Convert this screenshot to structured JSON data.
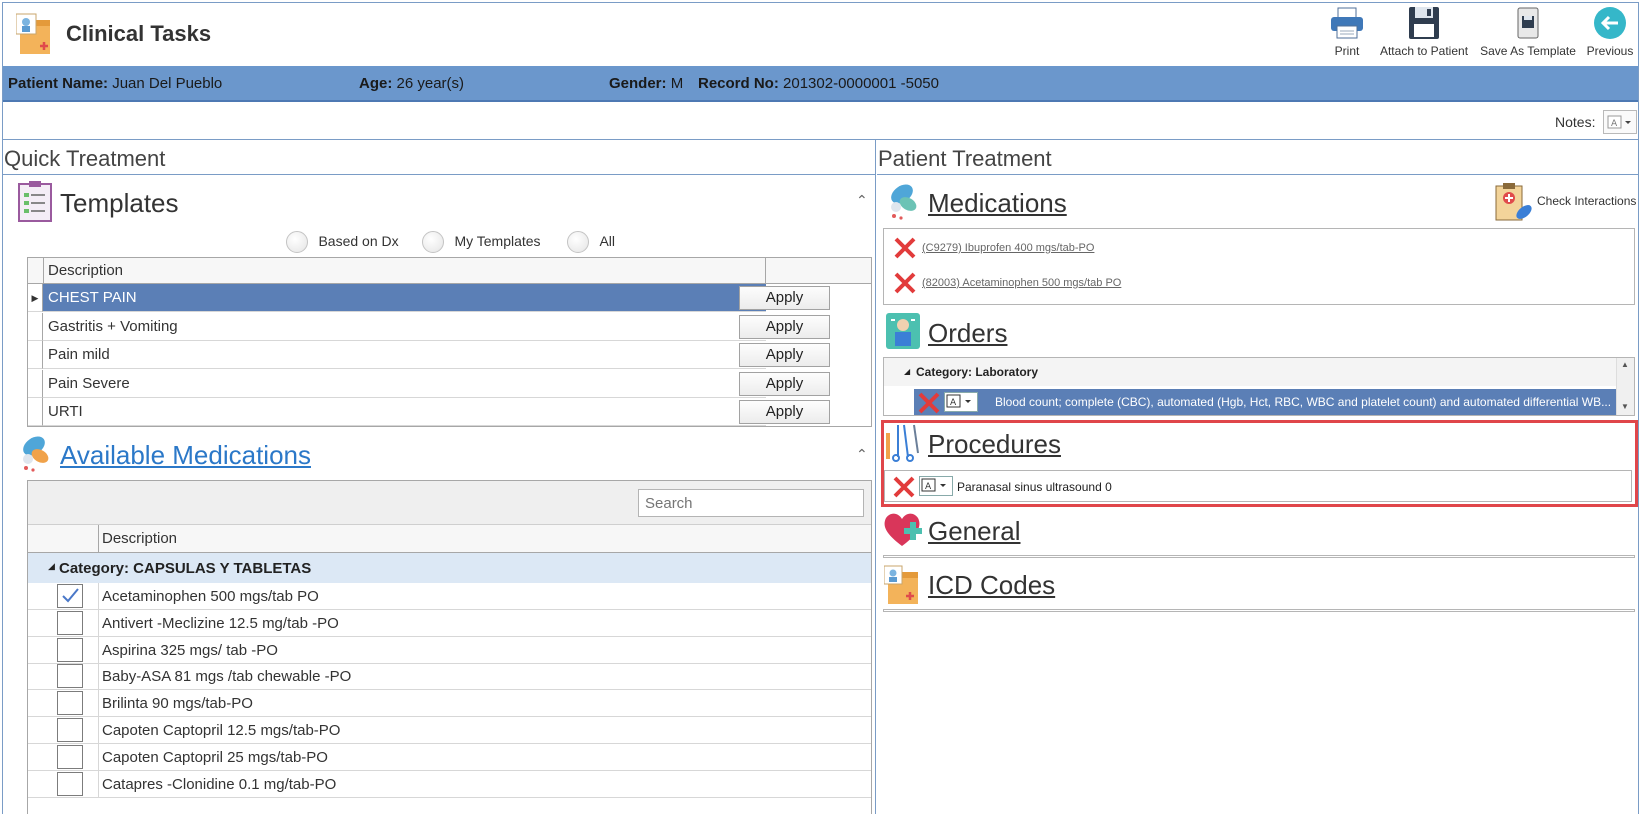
{
  "app": {
    "title": "Clinical Tasks"
  },
  "toolbar": {
    "print": "Print",
    "attach": "Attach to Patient",
    "save_template": "Save As Template",
    "previous": "Previous"
  },
  "patient": {
    "name_label": "Patient Name:",
    "name": "Juan Del Pueblo",
    "age_label": "Age:",
    "age": "26 year(s)",
    "gender_label": "Gender:",
    "gender": "M",
    "record_label": "Record No:",
    "record": "201302-0000001 -5050"
  },
  "notes": {
    "label": "Notes:"
  },
  "quick_treatment": {
    "title": "Quick Treatment",
    "templates": {
      "title": "Templates",
      "filters": [
        "Based on Dx",
        "My Templates",
        "All"
      ],
      "column": "Description",
      "rows": [
        {
          "description": "CHEST PAIN",
          "action": "Apply",
          "selected": true
        },
        {
          "description": "Gastritis + Vomiting",
          "action": "Apply"
        },
        {
          "description": "Pain mild",
          "action": "Apply"
        },
        {
          "description": "Pain Severe",
          "action": "Apply"
        },
        {
          "description": "URTI",
          "action": "Apply"
        }
      ]
    },
    "available_medications": {
      "title": "Available Medications",
      "search_placeholder": "Search",
      "column": "Description",
      "category": "Category: CAPSULAS Y TABLETAS",
      "items": [
        {
          "label": "Acetaminophen 500 mgs/tab PO",
          "checked": true
        },
        {
          "label": "Antivert -Meclizine 12.5 mg/tab -PO",
          "checked": false
        },
        {
          "label": "Aspirina 325 mgs/ tab -PO",
          "checked": false
        },
        {
          "label": "Baby-ASA 81 mgs /tab chewable -PO",
          "checked": false
        },
        {
          "label": "Brilinta 90 mgs/tab-PO",
          "checked": false
        },
        {
          "label": "Capoten Captopril 12.5 mgs/tab-PO",
          "checked": false
        },
        {
          "label": "Capoten Captopril 25 mgs/tab-PO",
          "checked": false
        },
        {
          "label": "Catapres -Clonidine 0.1 mg/tab-PO",
          "checked": false
        }
      ]
    }
  },
  "patient_treatment": {
    "title": "Patient Treatment",
    "medications": {
      "title": "Medications",
      "check_interactions": "Check Interactions",
      "items": [
        "(C9279) Ibuprofen 400 mgs/tab-PO",
        "(82003) Acetaminophen 500 mgs/tab  PO"
      ]
    },
    "orders": {
      "title": "Orders",
      "category": "Category: Laboratory",
      "items": [
        "Blood count; complete (CBC), automated (Hgb, Hct, RBC, WBC and platelet count) and automated differential WB..."
      ]
    },
    "procedures": {
      "title": "Procedures",
      "items": [
        "Paranasal sinus ultrasound 0"
      ]
    },
    "general": {
      "title": "General"
    },
    "icd_codes": {
      "title": "ICD Codes"
    }
  },
  "colors": {
    "banner": "#6b97cc",
    "selected_row": "#5b7fb6",
    "highlight_border": "#e0464a",
    "link_blue": "#2b78c8"
  }
}
